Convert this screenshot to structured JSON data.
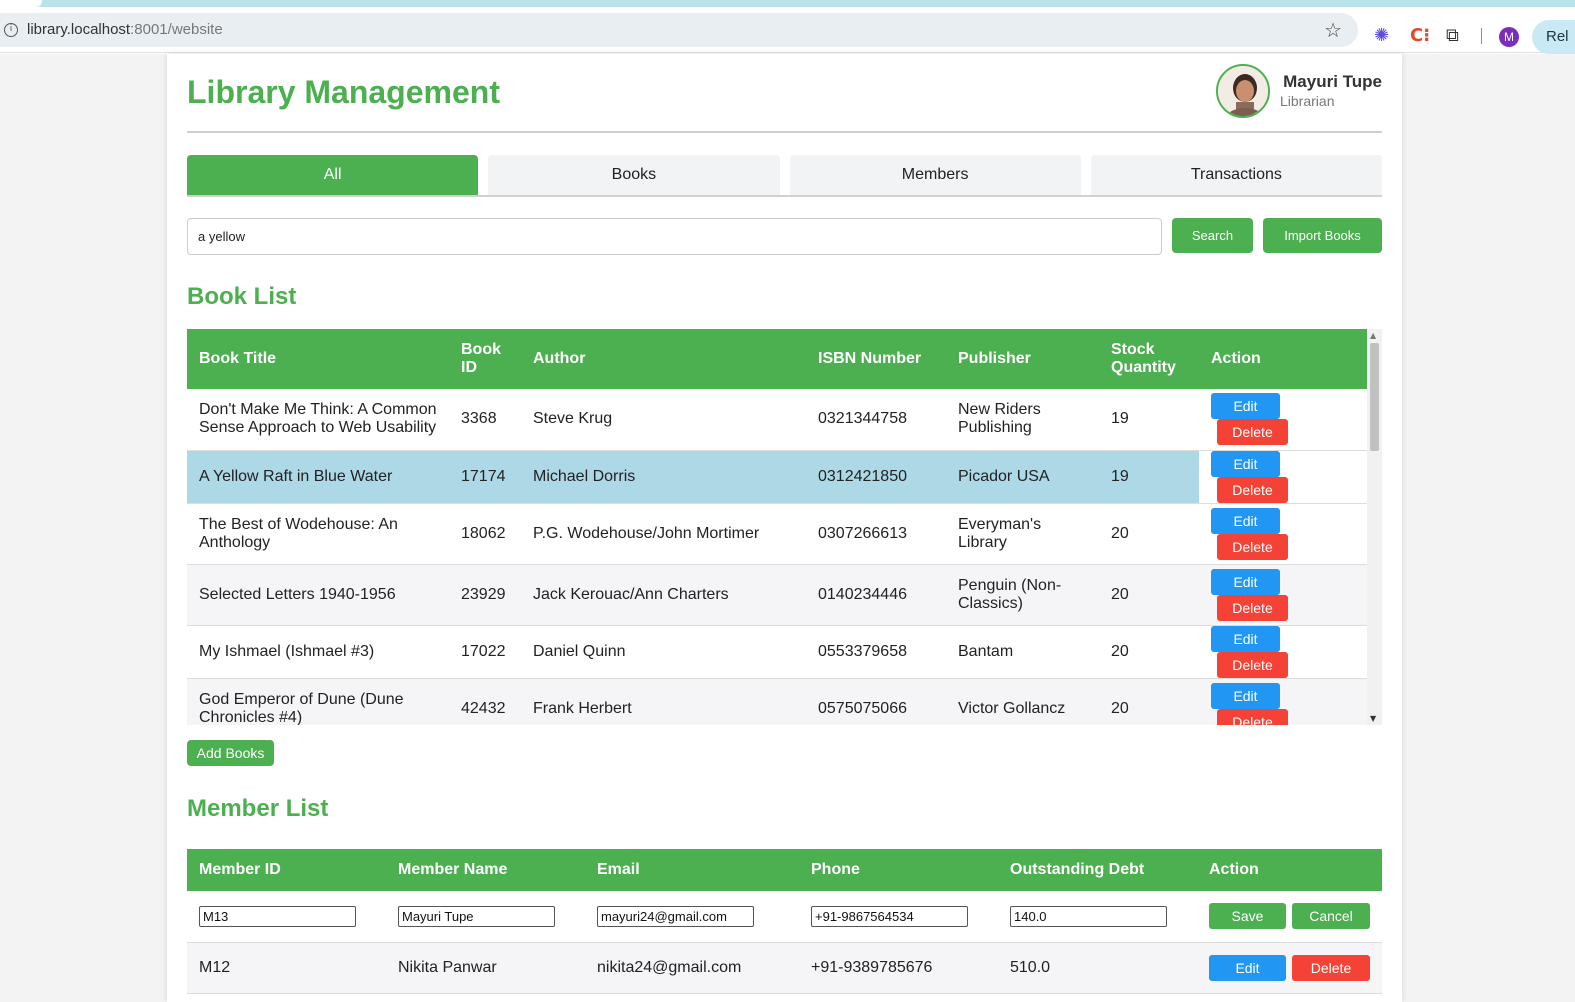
{
  "browser": {
    "url_host": "library.localhost",
    "url_rest": ":8001/website",
    "profile_initial": "M",
    "relaunch_label": "Rel"
  },
  "app": {
    "title": "Library Management",
    "user": {
      "name": "Mayuri Tupe",
      "role": "Librarian"
    }
  },
  "tabs": [
    {
      "label": "All",
      "active": true
    },
    {
      "label": "Books",
      "active": false
    },
    {
      "label": "Members",
      "active": false
    },
    {
      "label": "Transactions",
      "active": false
    }
  ],
  "search": {
    "value": "a yellow",
    "search_label": "Search",
    "import_label": "Import Books"
  },
  "books": {
    "title": "Book List",
    "headers": [
      "Book Title",
      "Book ID",
      "Author",
      "ISBN Number",
      "Publisher",
      "Stock Quantity",
      "Action"
    ],
    "rows": [
      {
        "title": "Don't Make Me Think: A Common Sense Approach to Web Usability",
        "id": "3368",
        "author": "Steve Krug",
        "isbn": "0321344758",
        "publisher": "New Riders Publishing",
        "stock": "19"
      },
      {
        "title": "A Yellow Raft in Blue Water",
        "id": "17174",
        "author": "Michael Dorris",
        "isbn": "0312421850",
        "publisher": "Picador USA",
        "stock": "19"
      },
      {
        "title": "The Best of Wodehouse: An Anthology",
        "id": "18062",
        "author": "P.G. Wodehouse/John Mortimer",
        "isbn": "0307266613",
        "publisher": "Everyman's Library",
        "stock": "20"
      },
      {
        "title": "Selected Letters 1940-1956",
        "id": "23929",
        "author": "Jack Kerouac/Ann Charters",
        "isbn": "0140234446",
        "publisher": "Penguin (Non-Classics)",
        "stock": "20"
      },
      {
        "title": "My Ishmael (Ishmael #3)",
        "id": "17022",
        "author": "Daniel Quinn",
        "isbn": "0553379658",
        "publisher": "Bantam",
        "stock": "20"
      },
      {
        "title": "God Emperor of Dune (Dune Chronicles #4)",
        "id": "42432",
        "author": "Frank Herbert",
        "isbn": "0575075066",
        "publisher": "Victor Gollancz",
        "stock": "20"
      }
    ],
    "edit_label": "Edit",
    "delete_label": "Delete",
    "add_label": "Add Books"
  },
  "members": {
    "title": "Member List",
    "headers": [
      "Member ID",
      "Member Name",
      "Email",
      "Phone",
      "Outstanding Debt",
      "Action"
    ],
    "editing_row": {
      "id": "M13",
      "name": "Mayuri Tupe",
      "email": "mayuri24@gmail.com",
      "phone": "+91-9867564534",
      "debt": "140.0"
    },
    "rows": [
      {
        "id": "M12",
        "name": "Nikita Panwar",
        "email": "nikita24@gmail.com",
        "phone": "+91-9389785676",
        "debt": "510.0"
      }
    ],
    "save_label": "Save",
    "cancel_label": "Cancel",
    "edit_label": "Edit",
    "delete_label": "Delete"
  }
}
